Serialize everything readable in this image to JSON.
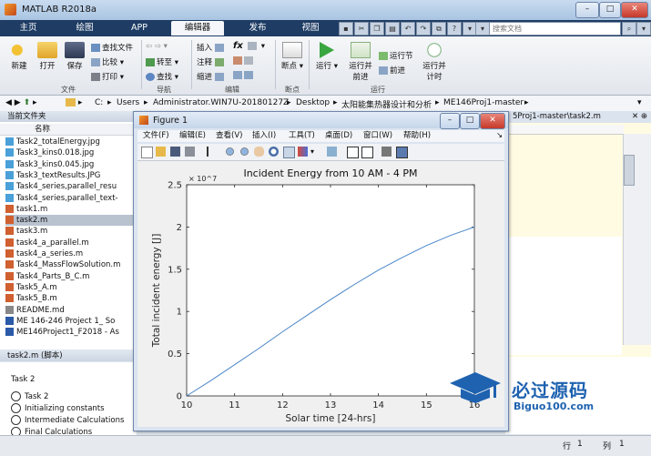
{
  "window": {
    "title": "MATLAB R2018a",
    "controls": [
      "–",
      "□",
      "✕"
    ]
  },
  "tabs": [
    "主页",
    "绘图",
    "APP",
    "编辑器",
    "发布",
    "视图"
  ],
  "active_tab": "编辑器",
  "search": {
    "placeholder": "搜索文档"
  },
  "ribbon": {
    "file": {
      "new": "新建",
      "open": "打开",
      "save": "保存",
      "find_files": "查找文件",
      "compare": "比较",
      "print": "打印",
      "group": "文件"
    },
    "navigate": {
      "goto": "转至",
      "find": "查找",
      "group": "导航"
    },
    "edit": {
      "insert": "插入",
      "comment": "注释",
      "indent": "缩进",
      "fx": "fx",
      "group": "编辑"
    },
    "breakpoints": {
      "label": "断点",
      "group": "断点"
    },
    "run": {
      "run": "运行",
      "run_advance_1": "运行并",
      "run_advance_2": "前进",
      "run_section": "运行节",
      "advance": "前进",
      "run_time_1": "运行并",
      "run_time_2": "计时",
      "group": "运行"
    }
  },
  "address": {
    "parts": [
      "C:",
      "Users",
      "Administrator.WIN7U-20180127Z",
      "Desktop",
      "太阳能集热器设计和分析",
      "ME146Proj1-master"
    ]
  },
  "left_panel": {
    "header": "当前文件夹",
    "column": "名称",
    "files": [
      "Task2_totalEnergy.jpg",
      "Task3_kins0.018.jpg",
      "Task3_kins0.045.jpg",
      "Task3_textResults.JPG",
      "Task4_series,parallel_resu",
      "Task4_series,parallel_text-",
      "task1.m",
      "task2.m",
      "task3.m",
      "task4_a_parallel.m",
      "task4_a_series.m",
      "Task4_MassFlowSolution.m",
      "Task4_Parts_B_C.m",
      "Task5_A.m",
      "Task5_B.m",
      "README.md",
      "ME 146-246 Project 1_ So",
      "ME146Project1_F2018 - As"
    ],
    "selected_index": 7,
    "details_header": "task2.m (脚本)",
    "details_title": "Task 2",
    "details_items": [
      "Task 2",
      "Initializing constants",
      "Intermediate Calculations",
      "Final Calculations"
    ]
  },
  "editor": {
    "tab_text": "5Proj1-master\\task2.m"
  },
  "figure": {
    "title": "Figure 1",
    "menu": [
      "文件(F)",
      "编辑(E)",
      "查看(V)",
      "插入(I)",
      "工具(T)",
      "桌面(D)",
      "窗口(W)",
      "帮助(H)"
    ]
  },
  "chart_data": {
    "type": "line",
    "title": "Incident Energy from 10 AM - 4 PM",
    "xlabel": "Solar time [24-hrs]",
    "ylabel": "Total incident energy [J]",
    "exponent_label": "× 10^7",
    "xlim": [
      10,
      16
    ],
    "ylim": [
      0,
      2.5
    ],
    "xticks": [
      10,
      11,
      12,
      13,
      14,
      15,
      16
    ],
    "yticks": [
      0,
      0.5,
      1,
      1.5,
      2,
      2.5
    ],
    "line_color": "#4a86c8",
    "x": [
      10,
      10.5,
      11,
      11.5,
      12,
      12.5,
      13,
      13.5,
      14,
      14.5,
      15,
      15.5,
      16
    ],
    "y": [
      0,
      0.18,
      0.37,
      0.56,
      0.76,
      0.95,
      1.14,
      1.32,
      1.49,
      1.64,
      1.78,
      1.9,
      2.0
    ]
  },
  "status": {
    "row_label": "行",
    "row_value": "1",
    "col_label": "列",
    "col_value": "1"
  },
  "watermark": {
    "text": "必过源码",
    "url": "Biguo100.com"
  }
}
